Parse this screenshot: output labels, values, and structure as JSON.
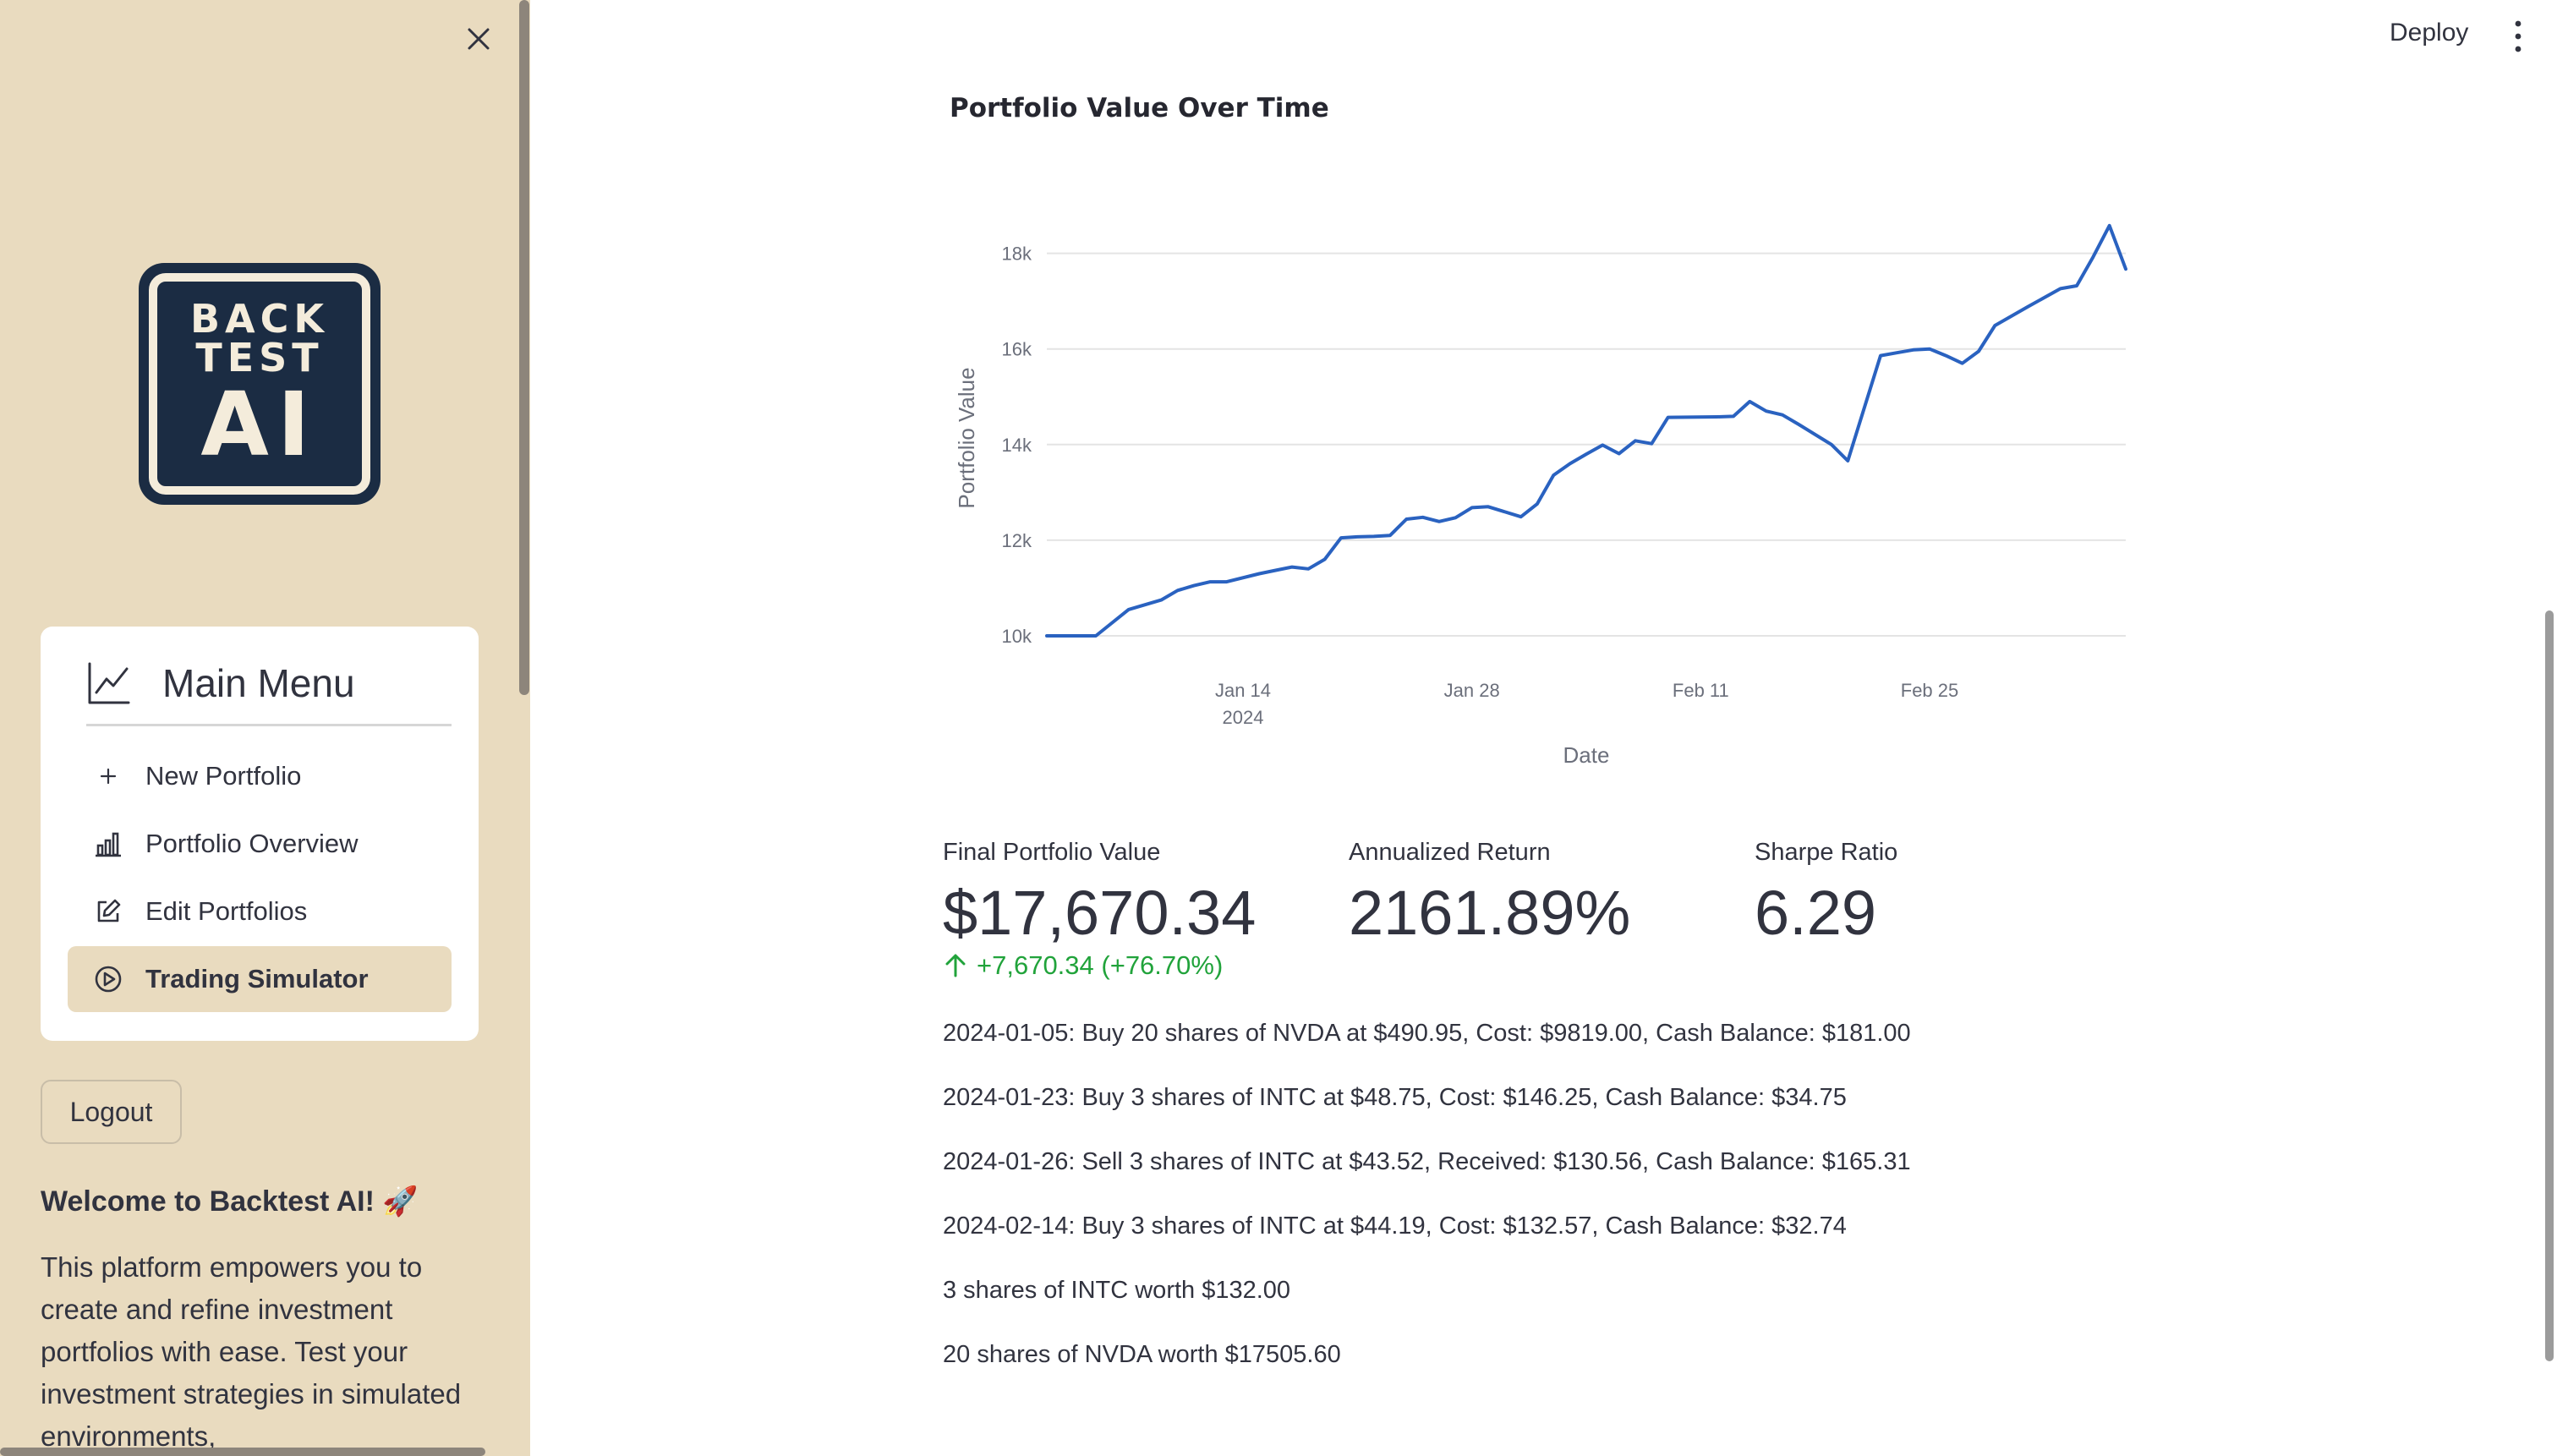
{
  "sidebar": {
    "logo_lines": [
      "BACK",
      "TEST",
      "AI"
    ],
    "menu_title": "Main Menu",
    "items": [
      {
        "label": "New Portfolio",
        "icon": "plus-icon"
      },
      {
        "label": "Portfolio Overview",
        "icon": "bar-chart-icon"
      },
      {
        "label": "Edit Portfolios",
        "icon": "edit-icon"
      },
      {
        "label": "Trading Simulator",
        "icon": "play-circle-icon",
        "active": true
      }
    ],
    "logout_label": "Logout",
    "welcome_title": "Welcome to Backtest AI! 🚀",
    "welcome_text": "This platform empowers you to create and refine investment portfolios with ease. Test your investment strategies in simulated environments,"
  },
  "header": {
    "deploy_label": "Deploy"
  },
  "chart_data": {
    "type": "line",
    "title": "Portfolio Value Over Time",
    "xlabel": "Date",
    "ylabel": "Portfolio Value",
    "x_ticks": [
      "Jan 14",
      "Jan 28",
      "Feb 11",
      "Feb 25"
    ],
    "x_tick_sub": "2024",
    "y_ticks": [
      "10k",
      "12k",
      "14k",
      "16k",
      "18k"
    ],
    "ylim": [
      10000,
      18700
    ],
    "xlim": [
      "2024-01-02",
      "2024-03-08"
    ],
    "grid": true,
    "color": "#2a62c0",
    "x": [
      "2024-01-02",
      "2024-01-05",
      "2024-01-07",
      "2024-01-09",
      "2024-01-10",
      "2024-01-11",
      "2024-01-12",
      "2024-01-13",
      "2024-01-15",
      "2024-01-16",
      "2024-01-17",
      "2024-01-18",
      "2024-01-19",
      "2024-01-20",
      "2024-01-21",
      "2024-01-22",
      "2024-01-23",
      "2024-01-24",
      "2024-01-25",
      "2024-01-26",
      "2024-01-27",
      "2024-01-28",
      "2024-01-29",
      "2024-01-31",
      "2024-02-01",
      "2024-02-02",
      "2024-02-03",
      "2024-02-04",
      "2024-02-05",
      "2024-02-06",
      "2024-02-07",
      "2024-02-08",
      "2024-02-09",
      "2024-02-12",
      "2024-02-13",
      "2024-02-14",
      "2024-02-15",
      "2024-02-16",
      "2024-02-17",
      "2024-02-19",
      "2024-02-20",
      "2024-02-22",
      "2024-02-23",
      "2024-02-24",
      "2024-02-25",
      "2024-02-26",
      "2024-02-27",
      "2024-02-28",
      "2024-02-29",
      "2024-03-02",
      "2024-03-04",
      "2024-03-05",
      "2024-03-06",
      "2024-03-07",
      "2024-03-08"
    ],
    "values": [
      10000,
      10000,
      10550,
      10750,
      10950,
      11050,
      11130,
      11130,
      11300,
      11370,
      11440,
      11400,
      11600,
      12050,
      12070,
      12080,
      12100,
      12440,
      12480,
      12390,
      12470,
      12680,
      12700,
      12490,
      12760,
      13360,
      13600,
      13800,
      13990,
      13810,
      14080,
      14020,
      14570,
      14580,
      14590,
      14900,
      14700,
      14620,
      14420,
      14000,
      13660,
      15860,
      15920,
      15980,
      16000,
      15860,
      15700,
      15950,
      16490,
      16880,
      17260,
      17320,
      17920,
      18580,
      17670
    ]
  },
  "metrics": [
    {
      "label": "Final Portfolio Value",
      "value": "$17,670.34",
      "delta": "+7,670.34 (+76.70%)"
    },
    {
      "label": "Annualized Return",
      "value": "2161.89%"
    },
    {
      "label": "Sharpe Ratio",
      "value": "6.29"
    }
  ],
  "transactions": [
    "2024-01-05: Buy 20 shares of NVDA at $490.95, Cost: $9819.00, Cash Balance: $181.00",
    "2024-01-23: Buy 3 shares of INTC at $48.75, Cost: $146.25, Cash Balance: $34.75",
    "2024-01-26: Sell 3 shares of INTC at $43.52, Received: $130.56, Cash Balance: $165.31",
    "2024-02-14: Buy 3 shares of INTC at $44.19, Cost: $132.57, Cash Balance: $32.74",
    "3 shares of INTC worth $132.00",
    "20 shares of NVDA worth $17505.60"
  ],
  "colors": {
    "sidebar_bg": "#e9dbbf",
    "line": "#2a62c0",
    "delta_positive": "#21a33b",
    "logo_bg": "#1b2c43"
  }
}
